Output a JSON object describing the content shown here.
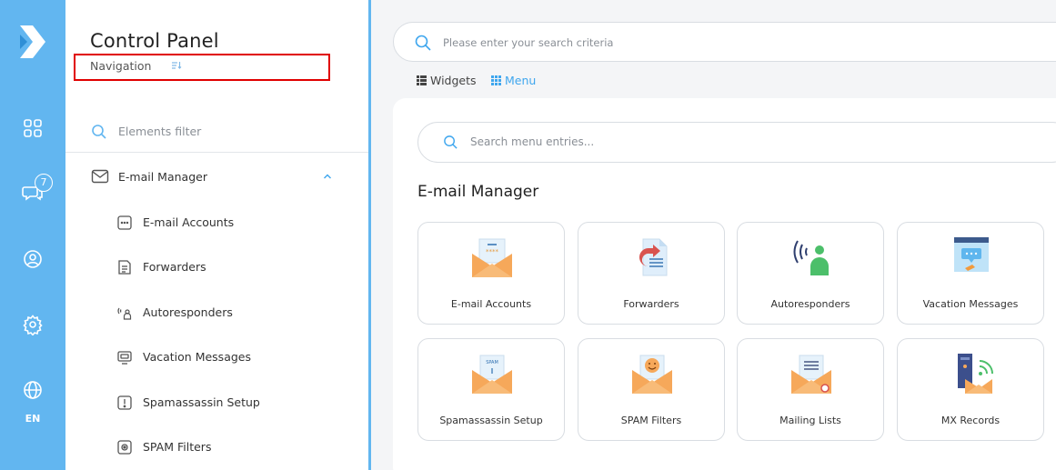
{
  "rail": {
    "badge_count": "7",
    "language": "EN",
    "icons": [
      "logo-icon",
      "dashboard-icon",
      "chat-icon",
      "user-icon",
      "settings-icon",
      "globe-icon"
    ]
  },
  "nav": {
    "title": "Control Panel",
    "subtitle": "Navigation",
    "filter_placeholder": "Elements filter",
    "group_label": "E-mail Manager",
    "items": [
      {
        "label": "E-mail Accounts",
        "icon": "email-accounts-icon"
      },
      {
        "label": "Forwarders",
        "icon": "forwarders-icon"
      },
      {
        "label": "Autoresponders",
        "icon": "autoresponders-icon"
      },
      {
        "label": "Vacation Messages",
        "icon": "vacation-messages-icon"
      },
      {
        "label": "Spamassassin Setup",
        "icon": "spamassassin-icon"
      },
      {
        "label": "SPAM Filters",
        "icon": "spam-filters-icon"
      }
    ]
  },
  "main": {
    "search_placeholder": "Please enter your search criteria",
    "tabs": [
      {
        "label": "Widgets",
        "active": false
      },
      {
        "label": "Menu",
        "active": true
      }
    ],
    "menu_search_placeholder": "Search menu entries...",
    "section_title": "E-mail Manager",
    "tiles": [
      {
        "label": "E-mail Accounts",
        "icon": "email-accounts-icon"
      },
      {
        "label": "Forwarders",
        "icon": "forwarders-icon"
      },
      {
        "label": "Autoresponders",
        "icon": "autoresponders-icon"
      },
      {
        "label": "Vacation Messages",
        "icon": "vacation-messages-icon"
      },
      {
        "label": "Spamassassin Setup",
        "icon": "spamassassin-icon"
      },
      {
        "label": "SPAM Filters",
        "icon": "spam-filters-icon"
      },
      {
        "label": "Mailing Lists",
        "icon": "mailing-lists-icon"
      },
      {
        "label": "MX Records",
        "icon": "mx-records-icon"
      }
    ]
  },
  "colors": {
    "accent": "#62b6f0",
    "active_tab": "#3ea6ee",
    "highlight_box": "#e00000"
  }
}
